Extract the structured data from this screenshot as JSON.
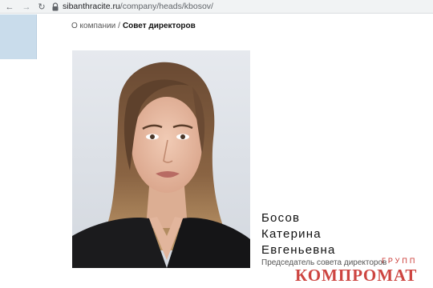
{
  "browser": {
    "back_icon": "arrow-left-icon",
    "forward_icon": "arrow-right-icon",
    "reload_icon": "reload-icon",
    "lock_icon": "lock-icon",
    "url_host": "sibanthracite.ru",
    "url_path": "/company/heads/kbosov/"
  },
  "breadcrumb": {
    "parent": "О компании",
    "separator": "/",
    "current": "Совет директоров"
  },
  "person": {
    "surname": "Босов",
    "first_name": "Катерина",
    "patronymic": "Евгеньевна",
    "position": "Председатель совета директоров"
  },
  "watermark": {
    "text": "КОМПРОМАТ ГРУПП",
    "color": "#c8312c"
  }
}
